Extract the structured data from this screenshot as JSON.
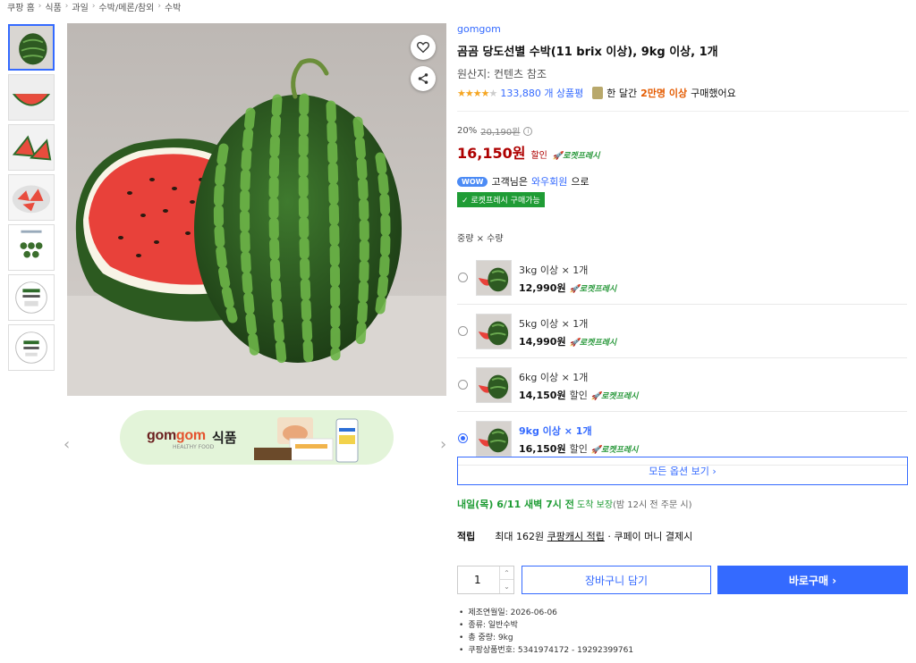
{
  "breadcrumb": [
    "쿠팡 홈",
    "식품",
    "과일",
    "수박/메론/참외",
    "수박"
  ],
  "banner": {
    "brand_part1": "gom",
    "brand_part2": "gom",
    "brand_sub": "HEALTHY FOOD",
    "label": "식품"
  },
  "product": {
    "brand": "gomgom",
    "title": "곰곰 당도선별 수박(11 brix 이상), 9kg 이상, 1개",
    "origin": "원산지: 컨텐츠 참조",
    "rating": 4,
    "review_count": "133,880 개 상품평",
    "purchase_prefix": "한 달간",
    "purchase_highlight": "2만명 이상",
    "purchase_suffix": "구매했어요"
  },
  "price": {
    "discount_rate": "20%",
    "original_price": "20,190원",
    "sale_price": "16,150원",
    "discount_label": "할인",
    "rocket_label": "로켓프레시"
  },
  "wow": {
    "badge": "WOW",
    "prefix": "고객님은",
    "link": "와우회원",
    "suffix": "으로",
    "fresh_badge": "✓ 로켓프레시 구매가능"
  },
  "options_header": "중량 × 수량",
  "options": [
    {
      "name": "3kg 이상 × 1개",
      "price": "12,990원",
      "discount": "",
      "rocket": "로켓프레시"
    },
    {
      "name": "5kg 이상 × 1개",
      "price": "14,990원",
      "discount": "",
      "rocket": "로켓프레시"
    },
    {
      "name": "6kg 이상 × 1개",
      "price": "14,150원",
      "discount": "할인",
      "rocket": "로켓프레시"
    },
    {
      "name": "9kg 이상 × 1개",
      "price": "16,150원",
      "discount": "할인",
      "rocket": "로켓프레시"
    }
  ],
  "all_options_button": "모든 옵션 보기 ›",
  "delivery": {
    "date": "내일(목) 6/11 새벽 7시 전",
    "arrive": "도착 보장",
    "note": "(밤 12시 전 주문 시)"
  },
  "points": {
    "label": "적립",
    "prefix": "최대 162원",
    "link": "쿠팡캐시 적립",
    "suffix": "· 쿠페이 머니 결제시"
  },
  "quantity": "1",
  "cart_button": "장바구니 담기",
  "buy_button": "바로구매 ›",
  "specs": [
    "제조연월일: 2026-06-06",
    "종류: 일반수박",
    "총 중량: 9kg",
    "쿠팡상품번호: 5341974172 - 19292399761"
  ],
  "colors": {
    "accent": "#346aff",
    "price_red": "#ae0000",
    "rocket_green": "#2c9a3e"
  },
  "icons": {
    "heart": "heart-icon",
    "share": "share-icon"
  }
}
